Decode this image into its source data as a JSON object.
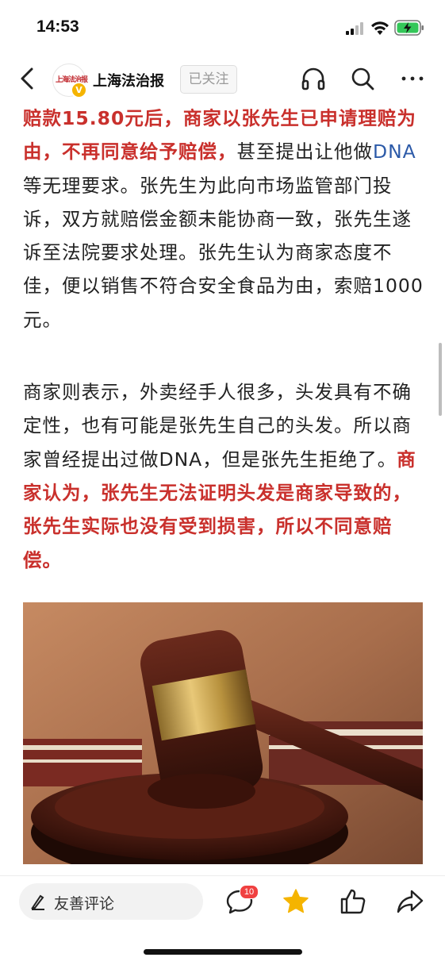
{
  "status_bar": {
    "time": "14:53"
  },
  "nav": {
    "account_name": "上海法治报",
    "avatar_text": "上海法治报",
    "verified_mark": "V",
    "follow_label": "已关注",
    "icons": [
      "back-arrow-icon",
      "headphones-icon",
      "search-icon",
      "more-icon"
    ]
  },
  "article": {
    "p1": {
      "red_a": "赔款15.80元后，商家以张先生已申请理赔为由，不再同意给予赔偿，",
      "text_a": "甚至提出让他做",
      "blue": "DNA",
      "text_b": "等无理要求。张先生为此向市场监管部门投诉，双方就赔偿金额未能协商一致，张先生遂诉至法院要求处理。张先生认为商家态度不佳，便以销售不符合安全食品为由，索赔1000元。"
    },
    "p2": {
      "text_a": "商家则表示，外卖经手人很多，头发具有不确定性，也有可能是张先生自己的头发。所以商家曾经提出过做DNA，但是张先生拒绝了。",
      "red_a": "商家认为，张先生无法证明头发是商家导致的，张先生实际也没有受到损害，所以不同意赔偿。"
    },
    "image": "judge-gavel-photo"
  },
  "bottom_bar": {
    "comment_placeholder": "友善评论",
    "comment_count": "10",
    "icons": [
      "edit-pen-icon",
      "comment-icon",
      "star-icon",
      "like-icon",
      "share-icon"
    ]
  },
  "colors": {
    "highlight_red": "#c9302c",
    "link_blue": "#2c5aa8",
    "star_yellow": "#f5b400",
    "badge_red": "#f04040"
  }
}
